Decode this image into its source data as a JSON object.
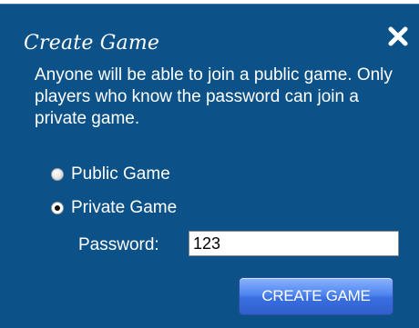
{
  "dialog": {
    "title": "Create Game",
    "description": "Anyone will be able to join a public game.  Only players who know the password can join a private game.",
    "close_icon": "close-x-icon",
    "options": [
      {
        "label": "Public Game",
        "checked": false
      },
      {
        "label": "Private Game",
        "checked": true
      }
    ],
    "password_label": "Password:",
    "password_value": "123",
    "create_button_label": "CREATE GAME"
  },
  "colors": {
    "dialog_background": "#0c5288",
    "button_blue": "#4f86ef",
    "text": "#ffffff"
  }
}
